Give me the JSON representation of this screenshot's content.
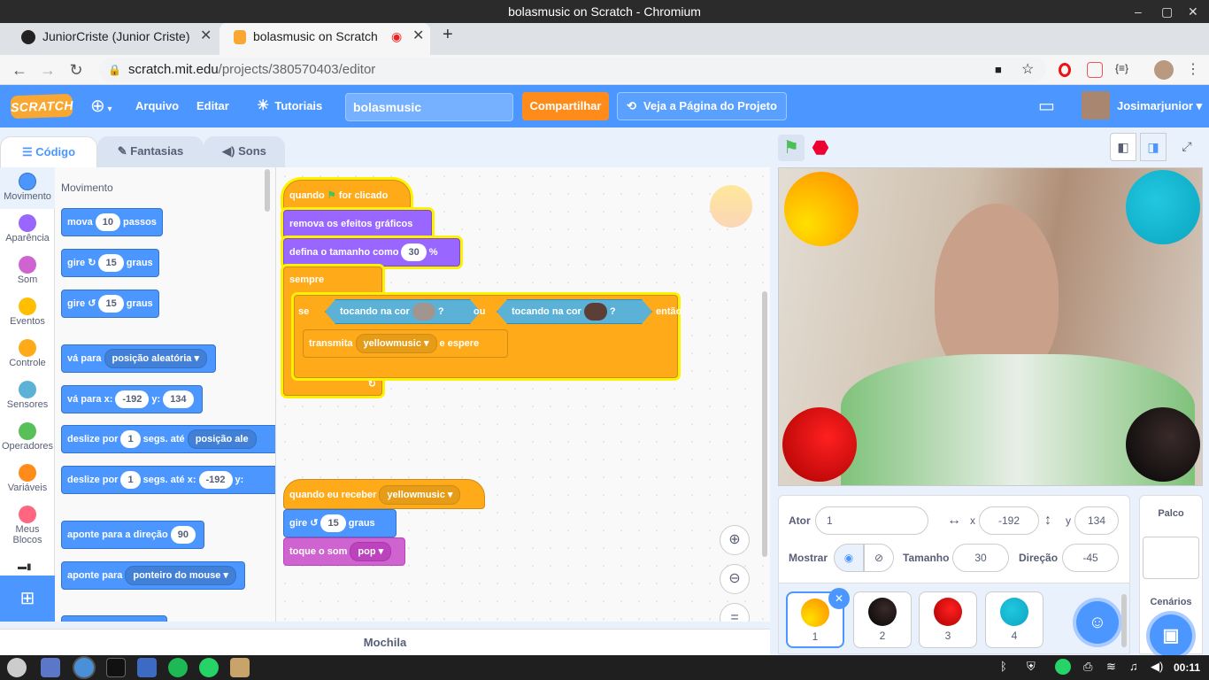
{
  "window": {
    "title": "bolasmusic on Scratch - Chromium",
    "minimize": "–",
    "close": "✕"
  },
  "tabs": [
    {
      "label": "JuniorCriste (Junior Criste)",
      "icon": "github-icon"
    },
    {
      "label": "bolasmusic on Scratch",
      "icon": "scratch-icon"
    }
  ],
  "address": {
    "host": "scratch.mit.edu",
    "path": "/projects/380570403/editor"
  },
  "menubar": {
    "logo": "SCRATCH",
    "file": "Arquivo",
    "edit": "Editar",
    "tutorials": "Tutoriais",
    "project_title": "bolasmusic",
    "share": "Compartilhar",
    "see_project": "Veja a Página do Projeto",
    "username": "Josimarjunior"
  },
  "editor_tabs": {
    "code": "Código",
    "costumes": "Fantasias",
    "sounds": "Sons"
  },
  "categories": [
    {
      "label": "Movimento",
      "color": "#4c97ff"
    },
    {
      "label": "Aparência",
      "color": "#9966ff"
    },
    {
      "label": "Som",
      "color": "#cf63cf"
    },
    {
      "label": "Eventos",
      "color": "#ffbf00"
    },
    {
      "label": "Controle",
      "color": "#ffab19"
    },
    {
      "label": "Sensores",
      "color": "#5cb1d6"
    },
    {
      "label": "Operadores",
      "color": "#59c059"
    },
    {
      "label": "Variáveis",
      "color": "#ff8c1a"
    },
    {
      "label": "Meus",
      "label2": "Blocos",
      "color": "#ff6680"
    }
  ],
  "palette": {
    "heading": "Movimento",
    "move": {
      "a": "mova",
      "v": "10",
      "b": "passos"
    },
    "turn_right": {
      "a": "gire",
      "v": "15",
      "b": "graus"
    },
    "turn_left": {
      "a": "gire",
      "v": "15",
      "b": "graus"
    },
    "goto": {
      "a": "vá para",
      "dd": "posição aleatória"
    },
    "goto_xy": {
      "a": "vá para x:",
      "x": "-192",
      "b": "y:",
      "y": "134"
    },
    "glide": {
      "a": "deslize por",
      "v": "1",
      "b": "segs. até",
      "dd": "posição ale"
    },
    "glide_xy": {
      "a": "deslize por",
      "v": "1",
      "b": "segs. até x:",
      "x": "-192",
      "c": "y:"
    },
    "point_dir": {
      "a": "aponte  para a direção",
      "v": "90"
    },
    "point_to": {
      "a": "aponte para",
      "dd": "ponteiro do mouse"
    }
  },
  "script1": {
    "hat": {
      "a": "quando",
      "b": "for clicado"
    },
    "clear_effects": "remova os efeitos gráficos",
    "set_size": {
      "a": "defina o tamanho como",
      "v": "30",
      "b": "%"
    },
    "forever": "sempre",
    "if": {
      "a": "se",
      "cond1": "tocando na cor",
      "q1": "?",
      "or": "ou",
      "cond2": "tocando na cor",
      "q2": "?",
      "then": "então"
    },
    "broadcast": {
      "a": "transmita",
      "dd": "yellowmusic",
      "b": "e espere"
    },
    "color1": "#a0968f",
    "color2": "#5b3e35"
  },
  "script2": {
    "hat": {
      "a": "quando eu receber",
      "dd": "yellowmusic"
    },
    "turn": {
      "a": "gire",
      "v": "15",
      "b": "graus"
    },
    "sound": {
      "a": "toque o som",
      "dd": "pop"
    }
  },
  "backpack": "Mochila",
  "sprite_info": {
    "sprite_label": "Ator",
    "sprite_name": "1",
    "x_label": "x",
    "x": "-192",
    "y_label": "y",
    "y": "134",
    "show_label": "Mostrar",
    "size_label": "Tamanho",
    "size": "30",
    "direction_label": "Direção",
    "direction": "-45"
  },
  "sprites": [
    {
      "name": "1",
      "color": "#ffb000"
    },
    {
      "name": "2",
      "color": "#111111"
    },
    {
      "name": "3",
      "color": "#dd1111"
    },
    {
      "name": "4",
      "color": "#19b6cf"
    }
  ],
  "stage_pane": {
    "title": "Palco",
    "backdrops": "Cenários"
  },
  "taskbar": {
    "time": "00:11"
  }
}
